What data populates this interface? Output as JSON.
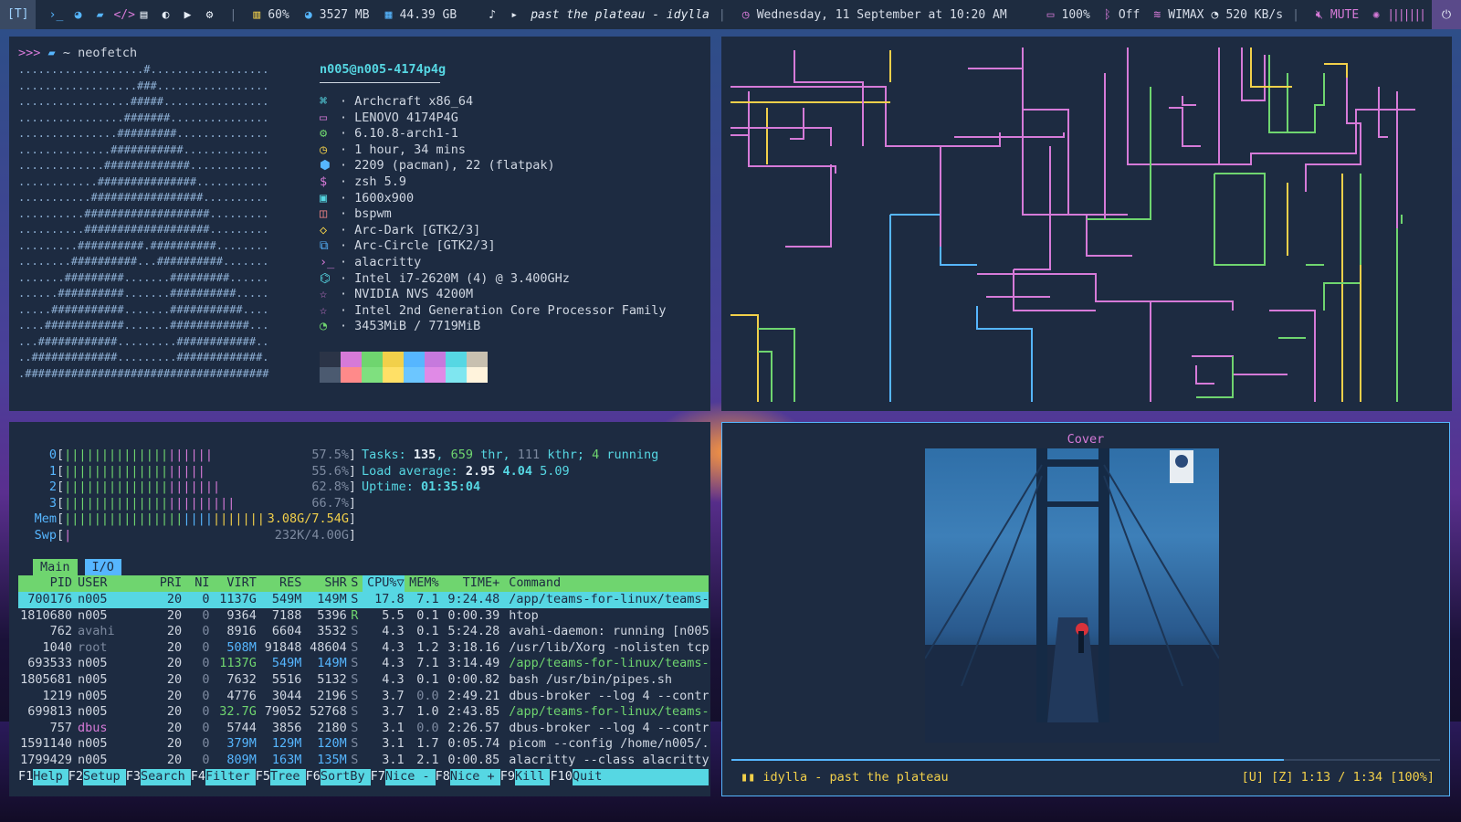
{
  "topbar": {
    "workspace": "[T]",
    "stats": {
      "volume_pct": "60%",
      "ram": "3527 MB",
      "disk": "44.39 GB"
    },
    "song": "past the plateau - idylla",
    "datetime": "Wednesday, 11 September at 10:20 AM",
    "battery": "100%",
    "bluetooth": "Off",
    "network": "WIMAX",
    "speed": "520 KB/s",
    "mute": "MUTE"
  },
  "neofetch": {
    "prompt_symbol": ">>>",
    "prompt_path": "~",
    "prompt_cmd": "neofetch",
    "userhost": "n005@n005-4174p4g",
    "info": [
      {
        "icon": "command-icon",
        "glyph": "⌘",
        "color": "#56d7e3",
        "text": "Archcraft x86_64"
      },
      {
        "icon": "monitor-icon",
        "glyph": "▭",
        "color": "#d67ad8",
        "text": "LENOVO 4174P4G"
      },
      {
        "icon": "gear-icon",
        "glyph": "⚙",
        "color": "#6fd56f",
        "text": "6.10.8-arch1-1"
      },
      {
        "icon": "clock-icon",
        "glyph": "◷",
        "color": "#f2d04a",
        "text": "1 hour, 34 mins"
      },
      {
        "icon": "package-icon",
        "glyph": "⬢",
        "color": "#56b6ff",
        "text": "2209 (pacman), 22 (flatpak)"
      },
      {
        "icon": "dollar-icon",
        "glyph": "$",
        "color": "#d67ad8",
        "text": "zsh 5.9"
      },
      {
        "icon": "image-icon",
        "glyph": "▣",
        "color": "#56d7e3",
        "text": "1600x900"
      },
      {
        "icon": "window-icon",
        "glyph": "◫",
        "color": "#ff8a8a",
        "text": "bspwm"
      },
      {
        "icon": "drop-icon",
        "glyph": "◇",
        "color": "#f2d04a",
        "text": "Arc-Dark [GTK2/3]"
      },
      {
        "icon": "copy-icon",
        "glyph": "⧉",
        "color": "#56b6ff",
        "text": "Arc-Circle [GTK2/3]"
      },
      {
        "icon": "terminal-icon",
        "glyph": "›_",
        "color": "#d67ad8",
        "text": "alacritty"
      },
      {
        "icon": "cpu-icon",
        "glyph": "⌬",
        "color": "#56d7e3",
        "text": "Intel i7-2620M (4) @ 3.400GHz"
      },
      {
        "icon": "star-icon",
        "glyph": "☆",
        "color": "#d67ad8",
        "text": "NVIDIA NVS 4200M"
      },
      {
        "icon": "star-icon",
        "glyph": "☆",
        "color": "#d67ad8",
        "text": "Intel 2nd Generation Core Processor Family"
      },
      {
        "icon": "pie-icon",
        "glyph": "◔",
        "color": "#6fd56f",
        "text": "3453MiB / 7719MiB"
      }
    ],
    "palette": [
      "#2b3447",
      "#d67ad8",
      "#6fd56f",
      "#f2d04a",
      "#56b6ff",
      "#c679dd",
      "#56d7e3",
      "#c8c0b0",
      "#4b5a70",
      "#ff8a8a",
      "#7fe07f",
      "#ffe066",
      "#6cc6ff",
      "#e08ae6",
      "#7fe6f0",
      "#fff3dc"
    ]
  },
  "htop": {
    "cpus": [
      {
        "label": "0",
        "pct": "57.5%",
        "fill": 0.575
      },
      {
        "label": "1",
        "pct": "55.6%",
        "fill": 0.556
      },
      {
        "label": "2",
        "pct": "62.8%",
        "fill": 0.628
      },
      {
        "label": "3",
        "pct": "66.7%",
        "fill": 0.667
      }
    ],
    "mem": {
      "label": "Mem",
      "text": "3.08G/7.54G",
      "fill": 0.95
    },
    "swp": {
      "label": "Swp",
      "text": "232K/4.00G",
      "fill": 0.02
    },
    "tasks": {
      "label": "Tasks:",
      "tasks": "135",
      "thr": "659",
      "kthr": "111",
      "running": "4",
      "thr_label": "thr,",
      "kthr_label": "kthr;",
      "running_label": "running"
    },
    "load": {
      "label": "Load average:",
      "l1": "2.95",
      "l5": "4.04",
      "l15": "5.09"
    },
    "uptime": {
      "label": "Uptime:",
      "value": "01:35:04"
    },
    "tabs": [
      "Main",
      "I/O"
    ],
    "columns": [
      "PID",
      "USER",
      "PRI",
      "NI",
      "VIRT",
      "RES",
      "SHR",
      "S",
      "CPU%▽",
      "MEM%",
      "TIME+",
      "Command"
    ],
    "rows": [
      [
        "700176",
        "n005",
        "20",
        "0",
        "1137G",
        "549M",
        "149M",
        "S",
        "17.8",
        "7.1",
        "9:24.48",
        "/app/teams-for-linux/teams-f"
      ],
      [
        "1810680",
        "n005",
        "20",
        "0",
        "9364",
        "7188",
        "5396",
        "R",
        "5.5",
        "0.1",
        "0:00.39",
        "htop"
      ],
      [
        "762",
        "avahi",
        "20",
        "0",
        "8916",
        "6604",
        "3532",
        "S",
        "4.3",
        "0.1",
        "5:24.28",
        "avahi-daemon: running [n005-"
      ],
      [
        "1040",
        "root",
        "20",
        "0",
        "508M",
        "91848",
        "48604",
        "S",
        "4.3",
        "1.2",
        "3:18.16",
        "/usr/lib/Xorg -nolisten tcp"
      ],
      [
        "693533",
        "n005",
        "20",
        "0",
        "1137G",
        "549M",
        "149M",
        "S",
        "4.3",
        "7.1",
        "3:14.49",
        "/app/teams-for-linux/teams-f"
      ],
      [
        "1805681",
        "n005",
        "20",
        "0",
        "7632",
        "5516",
        "5132",
        "S",
        "4.3",
        "0.1",
        "0:00.82",
        "bash /usr/bin/pipes.sh"
      ],
      [
        "1219",
        "n005",
        "20",
        "0",
        "4776",
        "3044",
        "2196",
        "S",
        "3.7",
        "0.0",
        "2:49.21",
        "dbus-broker --log 4 --contro"
      ],
      [
        "699813",
        "n005",
        "20",
        "0",
        "32.7G",
        "79052",
        "52768",
        "S",
        "3.7",
        "1.0",
        "2:43.85",
        "/app/teams-for-linux/teams-f"
      ],
      [
        "757",
        "dbus",
        "20",
        "0",
        "5744",
        "3856",
        "2180",
        "S",
        "3.1",
        "0.0",
        "2:26.57",
        "dbus-broker --log 4 --contro"
      ],
      [
        "1591140",
        "n005",
        "20",
        "0",
        "379M",
        "129M",
        "120M",
        "S",
        "3.1",
        "1.7",
        "0:05.74",
        "picom --config /home/n005/.c"
      ],
      [
        "1799429",
        "n005",
        "20",
        "0",
        "809M",
        "163M",
        "135M",
        "S",
        "3.1",
        "2.1",
        "0:00.85",
        "alacritty --class alacritty-"
      ]
    ],
    "fkeys": [
      [
        "F1",
        "Help"
      ],
      [
        "F2",
        "Setup"
      ],
      [
        "F3",
        "Search"
      ],
      [
        "F4",
        "Filter"
      ],
      [
        "F5",
        "Tree"
      ],
      [
        "F6",
        "SortBy"
      ],
      [
        "F7",
        "Nice -"
      ],
      [
        "F8",
        "Nice +"
      ],
      [
        "F9",
        "Kill"
      ],
      [
        "F10",
        "Quit"
      ]
    ]
  },
  "music": {
    "cover_title": "Cover",
    "now_playing": "idylla - past the plateau",
    "status_glyph": "▮▮",
    "flags": "[U] [Z]",
    "position": "1:13 / 1:34",
    "percent": "[100%]",
    "progress_fraction": 0.78
  }
}
